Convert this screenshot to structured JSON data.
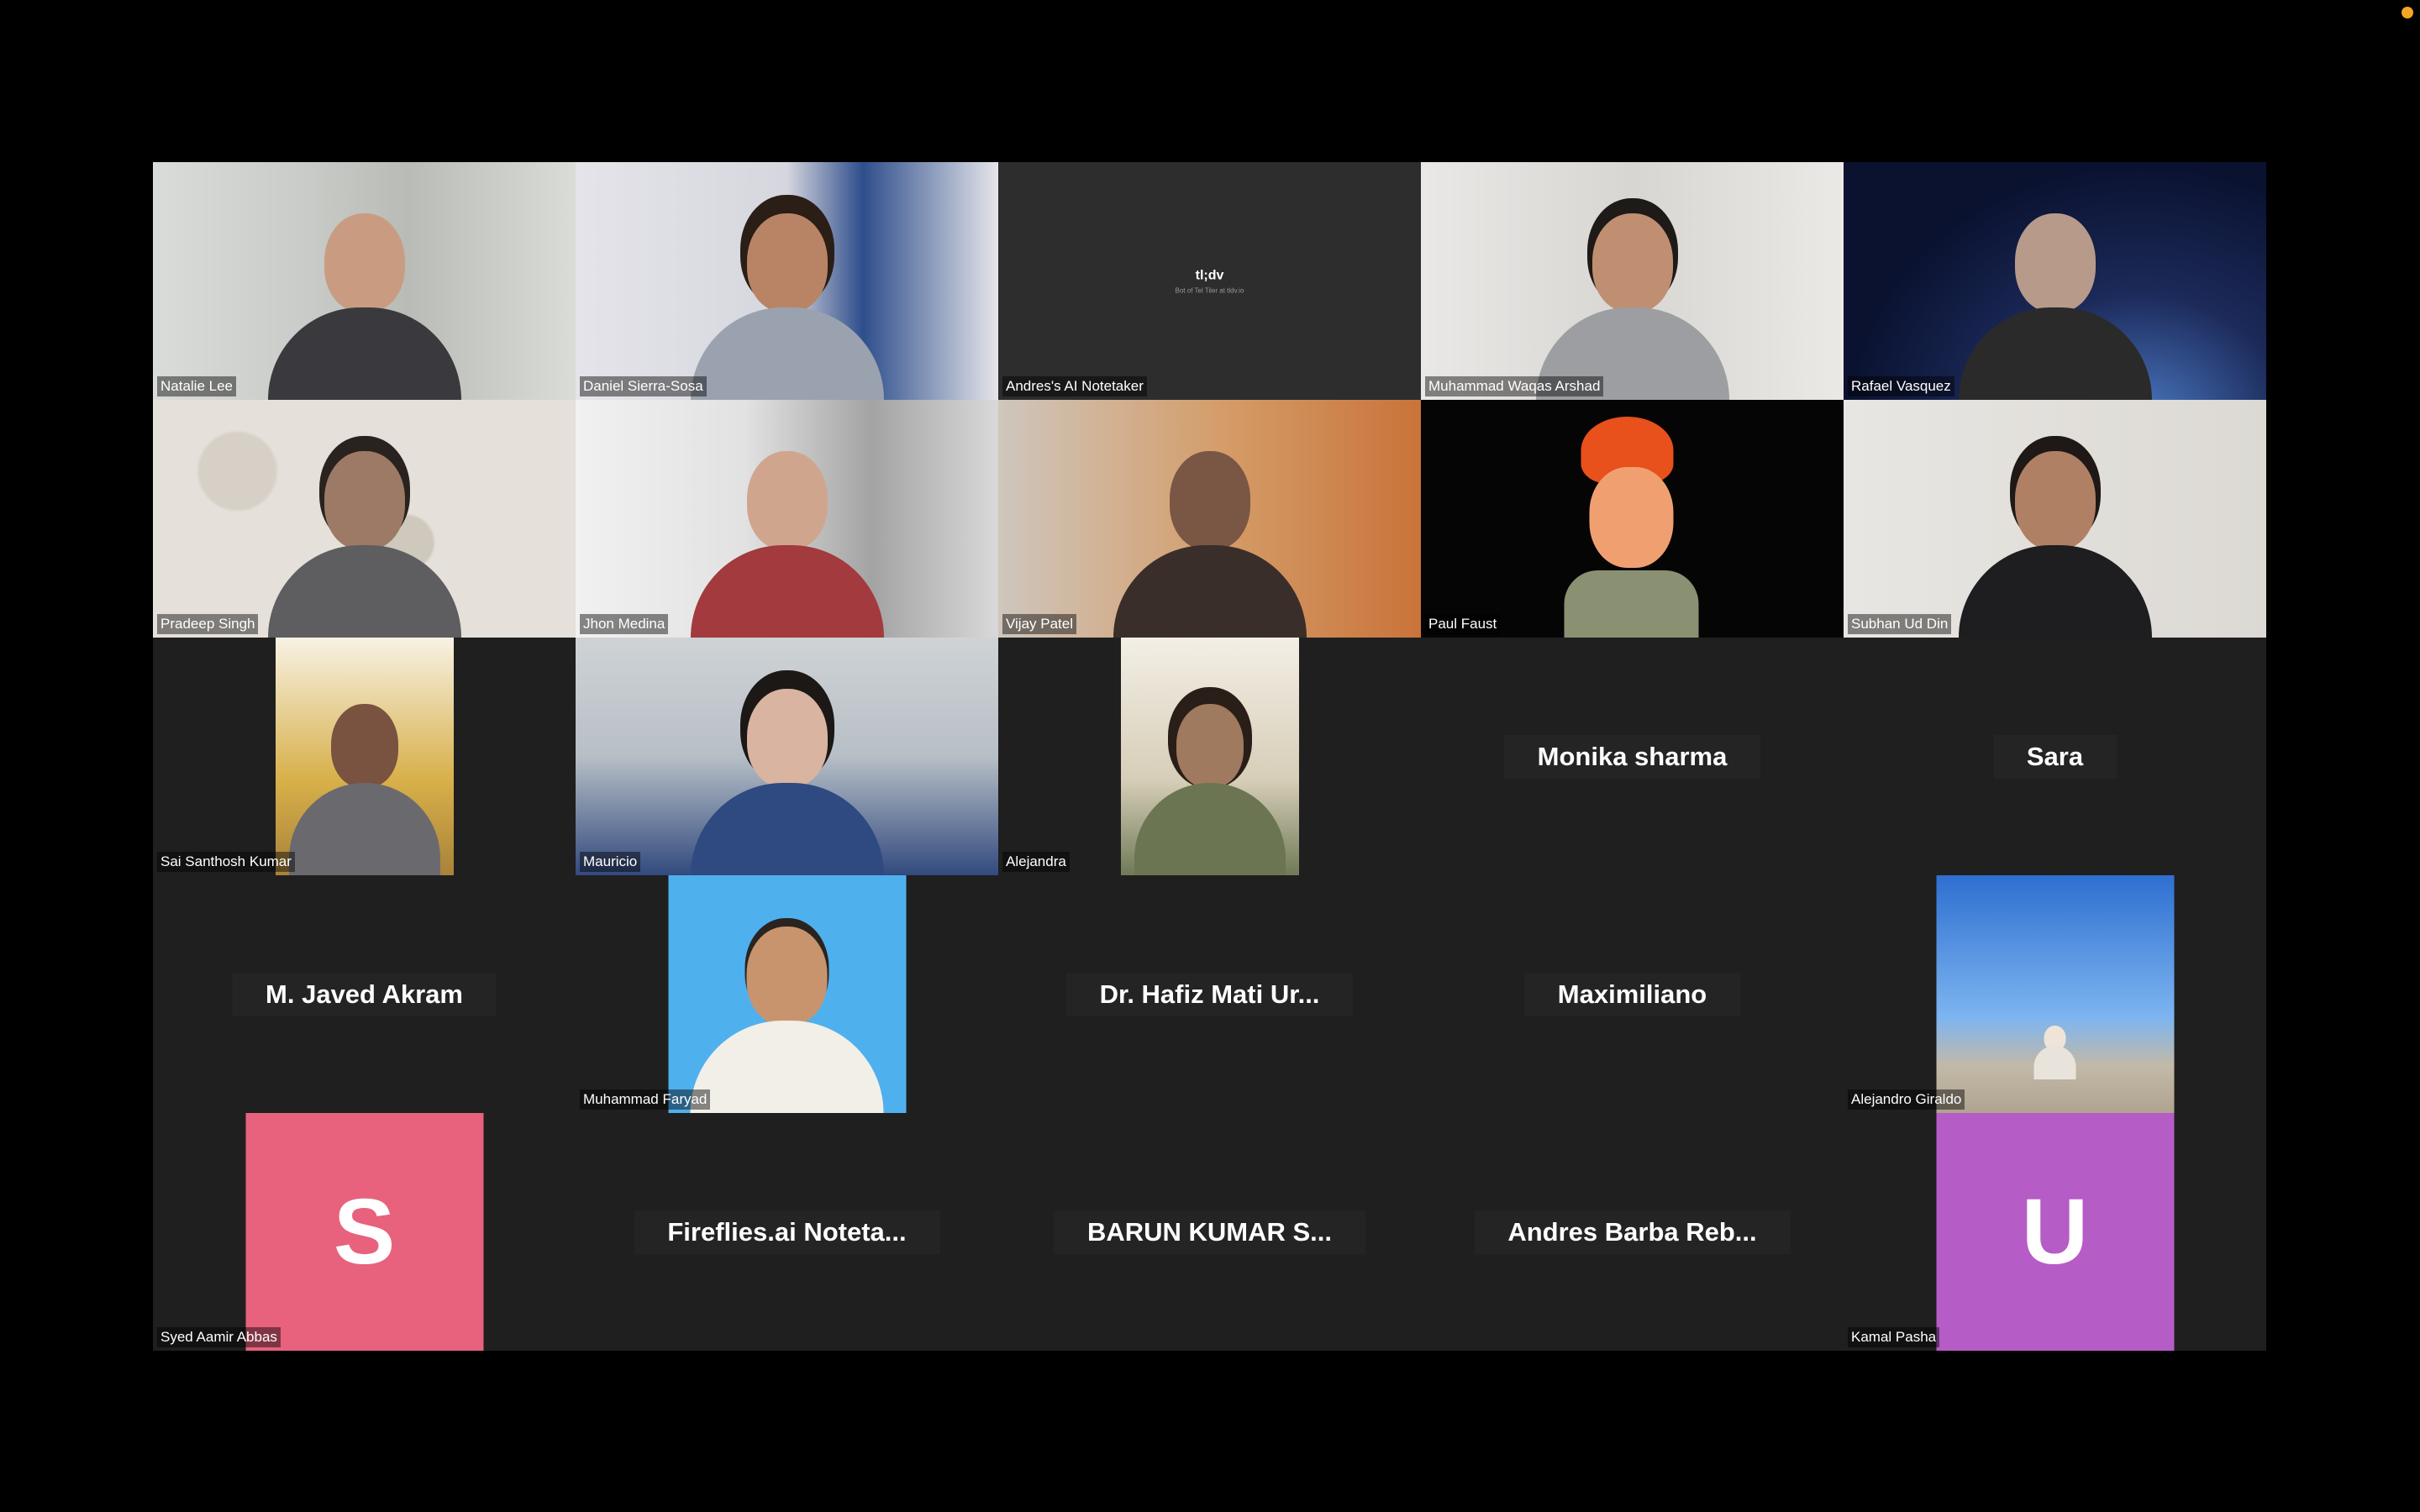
{
  "tiles": [
    {
      "name": "Natalie Lee",
      "kind": "video"
    },
    {
      "name": "Daniel Sierra-Sosa",
      "kind": "video"
    },
    {
      "name": "Andres's AI Notetaker",
      "kind": "video",
      "logo": "tl;dv",
      "logo_sub": "Bot of Tel Tiler at tldv.io"
    },
    {
      "name": "Muhammad Waqas Arshad",
      "kind": "video"
    },
    {
      "name": "Rafael Vasquez",
      "kind": "video"
    },
    {
      "name": "Pradeep Singh",
      "kind": "video"
    },
    {
      "name": "Jhon Medina",
      "kind": "video"
    },
    {
      "name": "Vijay Patel",
      "kind": "video"
    },
    {
      "name": "Paul Faust",
      "kind": "video"
    },
    {
      "name": "Subhan Ud Din",
      "kind": "video"
    },
    {
      "name": "Sai Santhosh Kumar",
      "kind": "video"
    },
    {
      "name": "Mauricio",
      "kind": "video"
    },
    {
      "name": "Alejandra",
      "kind": "video"
    },
    {
      "name": "Monika sharma",
      "kind": "name-only"
    },
    {
      "name": "Sara",
      "kind": "name-only"
    },
    {
      "name": "M. Javed Akram",
      "kind": "name-only"
    },
    {
      "name": "Muhammad Faryad",
      "kind": "video"
    },
    {
      "name": "Dr. Hafiz Mati Ur...",
      "kind": "name-only"
    },
    {
      "name": "Maximiliano",
      "kind": "name-only"
    },
    {
      "name": "Alejandro Giraldo",
      "kind": "video"
    },
    {
      "name": "Syed Aamir Abbas",
      "kind": "avatar",
      "initial": "S",
      "color": "#e8627d"
    },
    {
      "name": "Fireflies.ai  Noteta...",
      "kind": "name-only"
    },
    {
      "name": "BARUN KUMAR S...",
      "kind": "name-only"
    },
    {
      "name": "Andres Barba Reb...",
      "kind": "name-only"
    },
    {
      "name": "Kamal Pasha",
      "kind": "avatar",
      "initial": "U",
      "color": "#b65cc6"
    }
  ],
  "colors": {
    "background": "#000000",
    "tile_background": "#1f1f1f",
    "recording_indicator": "#f5a623"
  }
}
